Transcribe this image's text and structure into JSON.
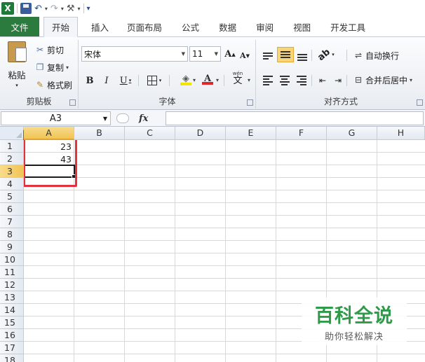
{
  "quick_access": {
    "app_icon": "excel-logo",
    "app_letter": "X",
    "items": [
      "save-icon",
      "undo-icon",
      "redo-icon",
      "tools-icon",
      "customize-qat-icon"
    ]
  },
  "tabs": [
    "文件",
    "开始",
    "插入",
    "页面布局",
    "公式",
    "数据",
    "审阅",
    "视图",
    "开发工具"
  ],
  "active_tab": "开始",
  "clipboard": {
    "paste": "粘贴",
    "cut": "剪切",
    "copy": "复制",
    "format_painter": "格式刷",
    "label": "剪贴板"
  },
  "font": {
    "name": "宋体",
    "size": "11",
    "bold": "B",
    "italic": "I",
    "underline": "U",
    "grow": "A",
    "shrink": "A",
    "font_color_letter": "A",
    "phonetic": "wén",
    "phonetic_char": "文",
    "label": "字体",
    "highlight_color": "#f5e400",
    "font_color": "#e0262b"
  },
  "alignment": {
    "wrap_text": "自动换行",
    "merge_center": "合并后居中",
    "label": "对齐方式"
  },
  "formula_bar": {
    "name_box": "A3",
    "fx": "fx",
    "value": ""
  },
  "sheet": {
    "columns": [
      "A",
      "B",
      "C",
      "D",
      "E",
      "F",
      "G",
      "H"
    ],
    "selected_column": "A",
    "rows": [
      "1",
      "2",
      "3",
      "4",
      "5",
      "6",
      "7",
      "8",
      "9",
      "10",
      "11",
      "12",
      "13",
      "14",
      "15",
      "16",
      "17",
      "18"
    ],
    "selected_row": "3",
    "cells": {
      "A1": "23",
      "A2": "43"
    },
    "highlight_color": "#e2323b"
  },
  "watermark": {
    "title": "百科全说",
    "subtitle": "助你轻松解决"
  }
}
